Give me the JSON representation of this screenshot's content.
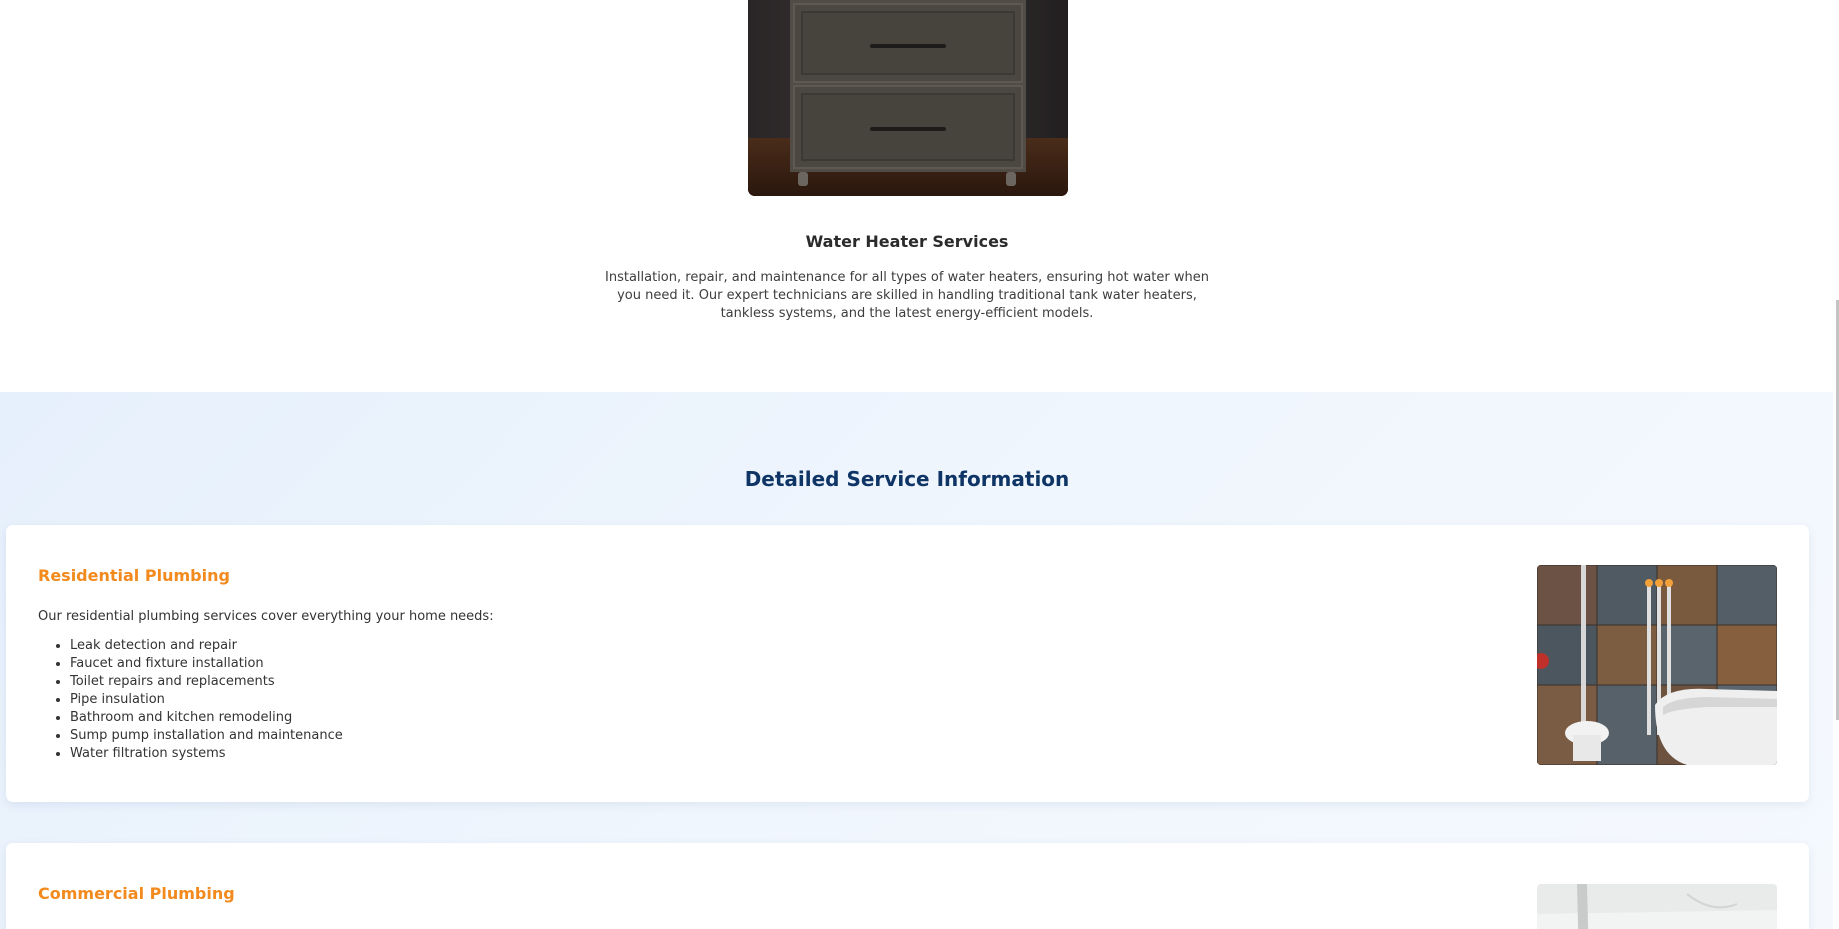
{
  "service": {
    "title": "Water Heater Services",
    "description": "Installation, repair, and maintenance for all types of water heaters, ensuring hot water when you need it. Our expert technicians are skilled in handling traditional tank water heaters, tankless systems, and the latest energy-efficient models."
  },
  "details": {
    "heading": "Detailed Service Information",
    "cards": [
      {
        "title": "Residential Plumbing",
        "intro": "Our residential plumbing services cover everything your home needs:",
        "items": [
          "Leak detection and repair",
          "Faucet and fixture installation",
          "Toilet repairs and replacements",
          "Pipe insulation",
          "Bathroom and kitchen remodeling",
          "Sump pump installation and maintenance",
          "Water filtration systems"
        ]
      },
      {
        "title": "Commercial Plumbing"
      }
    ]
  },
  "colors": {
    "accent": "#f28a1e",
    "heading": "#0f3566",
    "section_bg": "#e6f0fc"
  }
}
